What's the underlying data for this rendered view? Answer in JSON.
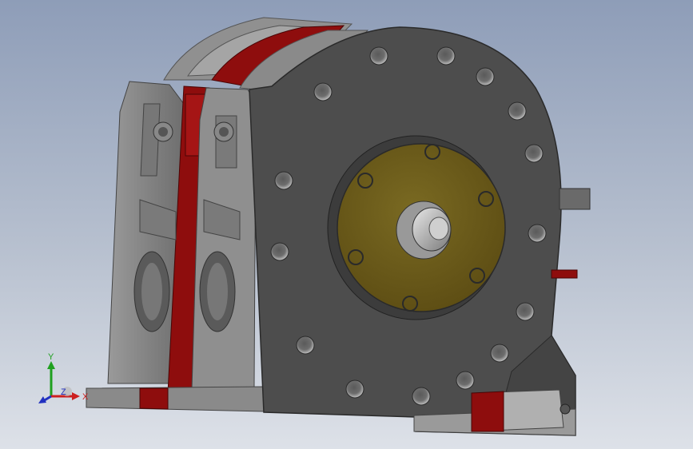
{
  "viewport": {
    "name": "3d-model-viewport",
    "colors": {
      "background_top": "#8e9db8",
      "background_bottom": "#dde1e8",
      "housing": "#4d4d4d",
      "housing_dark": "#3a3a3a",
      "side_plate": "#8a8a8a",
      "red_housing": "#8e0d0d",
      "gear_plate": "#6b5a18",
      "bolt_hole": "#9c9c9c"
    }
  },
  "triad": {
    "x_label": "X",
    "y_label": "Y",
    "z_label": "Z",
    "colors": {
      "x": "#cc2020",
      "y": "#20a020",
      "z": "#2030c0"
    }
  }
}
